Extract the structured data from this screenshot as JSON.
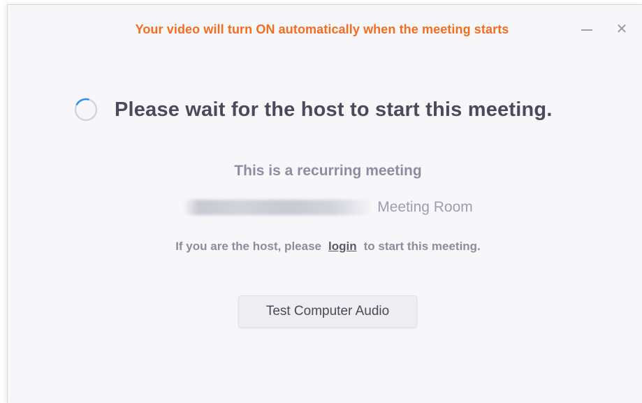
{
  "banner": {
    "text": "Your video will turn ON automatically when the meeting starts",
    "color": "#f26d21"
  },
  "window_controls": {
    "minimize_icon": "minimize-icon",
    "close_icon": "close-icon",
    "close_glyph": "✕"
  },
  "main": {
    "spinner_icon": "loading-spinner-icon",
    "spinner_color": "#2d8cff",
    "heading": "Please wait for the host to start this meeting.",
    "recurring_label": "This is a recurring meeting",
    "room_suffix": "Meeting Room",
    "host_prefix": "If you are the host, please",
    "login_link": "login",
    "host_suffix": "to start this meeting."
  },
  "buttons": {
    "test_audio": "Test Computer Audio"
  }
}
